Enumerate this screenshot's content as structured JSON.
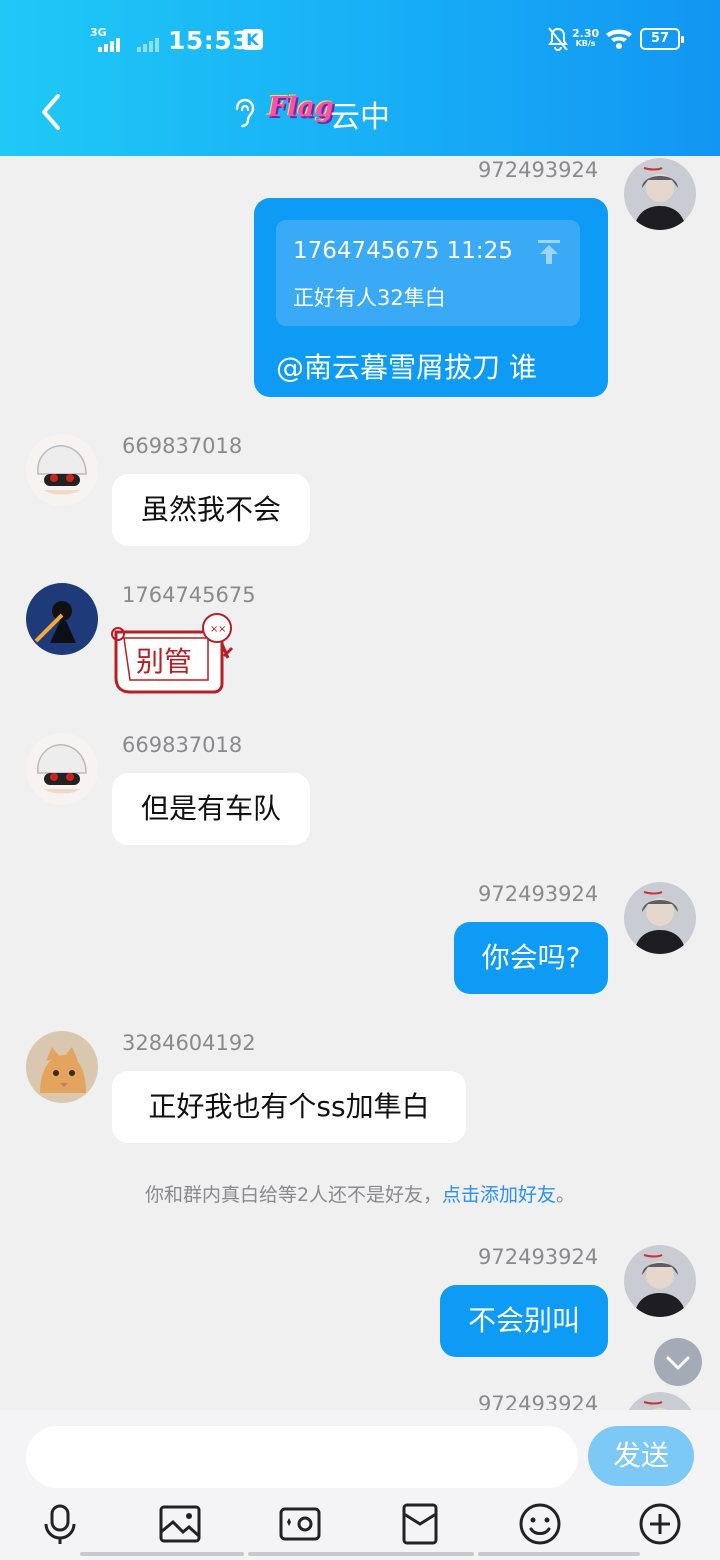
{
  "status_bar": {
    "network": "3G",
    "time": "15:53",
    "k_badge": "K",
    "speed_value": "2.30",
    "speed_unit": "KB/s",
    "battery": "57"
  },
  "header": {
    "flag_badge": "Flag",
    "title": "云中"
  },
  "messages": [
    {
      "side": "right",
      "sender": "972493924",
      "quote": {
        "meta": "1764745675 11:25",
        "text": "正好有人32隼白"
      },
      "text": "@南云暮雪屑拔刀 谁"
    },
    {
      "side": "left",
      "sender": "669837018",
      "text": "虽然我不会"
    },
    {
      "side": "left",
      "sender": "1764745675",
      "sticker_text": "别管"
    },
    {
      "side": "left",
      "sender": "669837018",
      "text": "但是有车队"
    },
    {
      "side": "right",
      "sender": "972493924",
      "text": "你会吗?"
    },
    {
      "side": "left",
      "sender": "3284604192",
      "text": "正好我也有个ss加隼白"
    },
    {
      "side": "right",
      "sender": "972493924",
      "text": "不会别叫"
    },
    {
      "side": "right",
      "sender": "972493924",
      "text": ""
    }
  ],
  "notice": {
    "text": "你和群内真白给等2人还不是好友，",
    "link": "点击添加好友",
    "suffix": "。"
  },
  "composer": {
    "send_label": "发送"
  },
  "toolbar_icons": [
    "microphone-icon",
    "image-icon",
    "camera-icon",
    "red-packet-icon",
    "emoji-icon",
    "plus-icon"
  ],
  "colors": {
    "header_gradient_start": "#1fc9f6",
    "header_gradient_end": "#1296f3",
    "outgoing_bubble": "#0d9bf5",
    "send_button": "#7cc8f7",
    "link": "#2d8ff0"
  }
}
